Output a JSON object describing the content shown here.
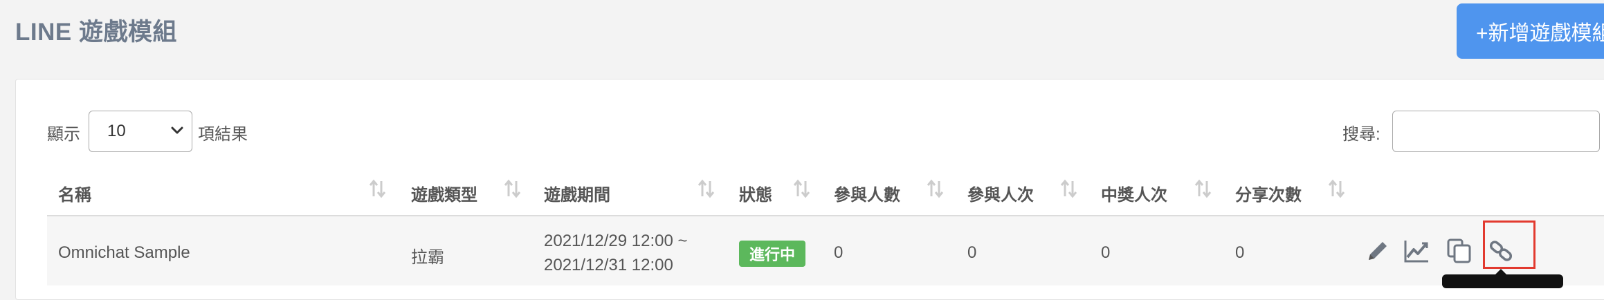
{
  "page_title": "LINE 遊戲模組",
  "add_button_label": "+新增遊戲模組",
  "length": {
    "show_label": "顯示",
    "selected_value": "10",
    "result_label": "項結果"
  },
  "search": {
    "label": "搜尋:",
    "value": ""
  },
  "table": {
    "columns": [
      "名稱",
      "遊戲類型",
      "遊戲期間",
      "狀態",
      "參與人數",
      "參與人次",
      "中獎人次",
      "分享次數"
    ],
    "rows": [
      {
        "name": "Omnichat Sample",
        "type": "拉霸",
        "period_start": "2021/12/29 12:00 ~",
        "period_end": "2021/12/31 12:00",
        "status": "進行中",
        "participants": "0",
        "participations": "0",
        "winners": "0",
        "shares": "0"
      }
    ]
  },
  "colors": {
    "accent": "#4f95ee",
    "status_active": "#5cb85c",
    "highlight": "#e23a2f",
    "title": "#6d7a8c"
  },
  "icons": {
    "sort": "sort-icon",
    "edit": "pencil-icon",
    "stats": "line-chart-icon",
    "copy": "copy-icon",
    "link": "link-icon",
    "select": "chevron-down-icon"
  }
}
